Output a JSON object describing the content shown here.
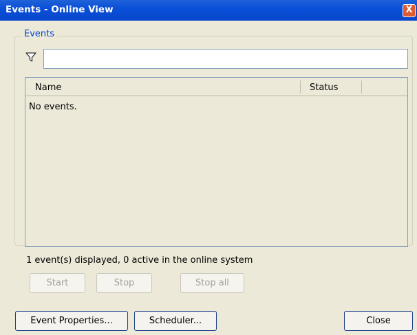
{
  "window": {
    "title": "Events - Online View",
    "close_glyph": "X"
  },
  "events_group": {
    "legend": "Events",
    "filter_icon": "filter-funnel-icon",
    "filter_value": ""
  },
  "events_list": {
    "columns": [
      "Name",
      "Status"
    ],
    "empty_message": "No events."
  },
  "status_text": "1 event(s) displayed, 0 active in the online system",
  "actions": {
    "start": "Start",
    "stop": "Stop",
    "stop_all": "Stop all"
  },
  "footer": {
    "event_properties": "Event Properties...",
    "scheduler": "Scheduler...",
    "close": "Close"
  },
  "colors": {
    "title_bar": "#0a4fd8",
    "accent_legend": "#0046d5",
    "close_button": "#e05a2f"
  }
}
